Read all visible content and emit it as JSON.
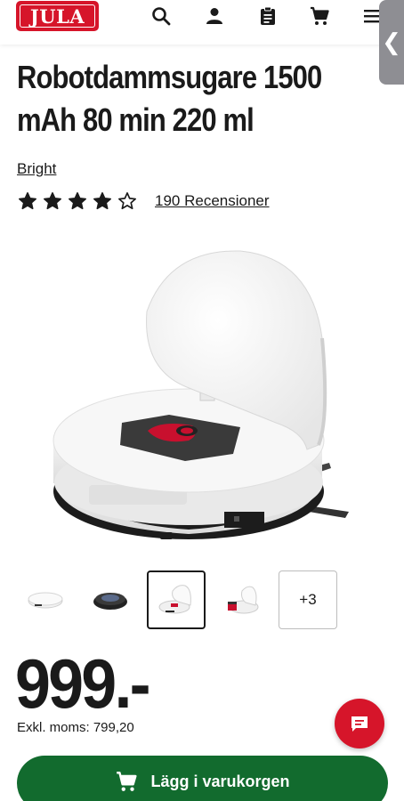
{
  "header": {
    "logo_text": "JULA",
    "icons": [
      "search-icon",
      "user-icon",
      "clipboard-icon",
      "cart-icon",
      "menu-icon"
    ],
    "side_tab_glyph": "❮"
  },
  "product": {
    "title": "Robotdammsugare 1500 mAh 80 min 220 ml",
    "brand": "Bright",
    "rating": 4,
    "rating_max": 5,
    "reviews_label": "190 Recensioner"
  },
  "gallery": {
    "selected_index": 2,
    "more_label": "+3"
  },
  "pricing": {
    "price": "999.-",
    "ex_vat": "Exkl. moms: 799,20"
  },
  "actions": {
    "add_to_cart_label": "Lägg i varukorgen"
  },
  "colors": {
    "brand_red": "#d6152a",
    "cart_green": "#126b2e"
  }
}
